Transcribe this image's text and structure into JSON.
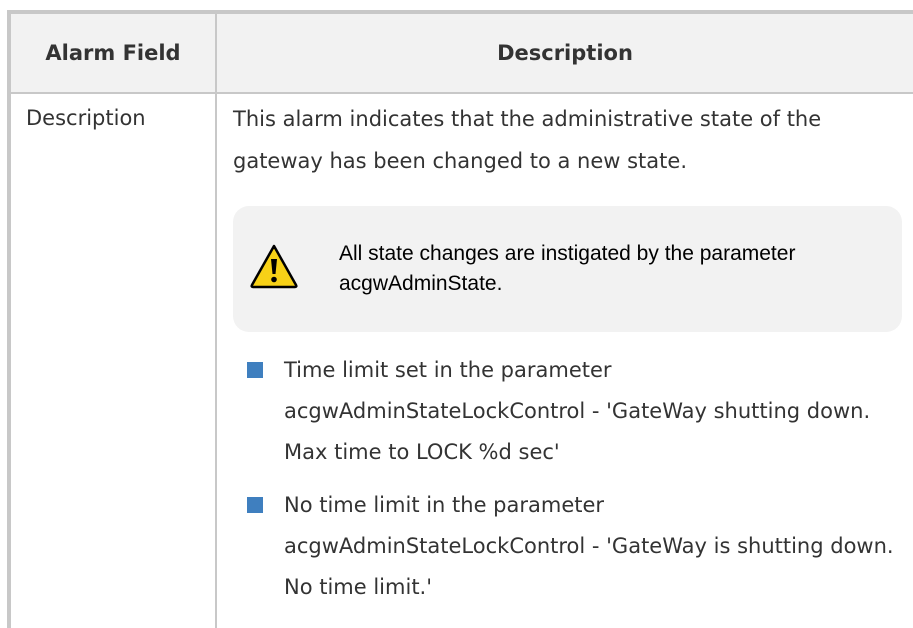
{
  "table": {
    "headers": {
      "field": "Alarm Field",
      "description": "Description"
    },
    "row": {
      "field": "Description",
      "description_text": "This alarm indicates that the administrative state of the gateway has been changed to a new state.",
      "note": {
        "icon": "warning-icon",
        "text": "All state changes are instigated by the parameter acgwAdminState."
      },
      "bullets": [
        "Time limit set in the parameter acgwAdminStateLockControl - 'GateWay shutting down. Max time to LOCK %d sec'",
        "No time limit in the parameter acgwAdminStateLockControl - 'GateWay is shutting down. No time limit.'"
      ]
    }
  },
  "colors": {
    "border": "#c8c8c8",
    "header_background": "#f2f2f2",
    "note_background": "#f2f2f2",
    "bullet_marker": "#3f7fbf",
    "warning_yellow": "#f7d117"
  }
}
